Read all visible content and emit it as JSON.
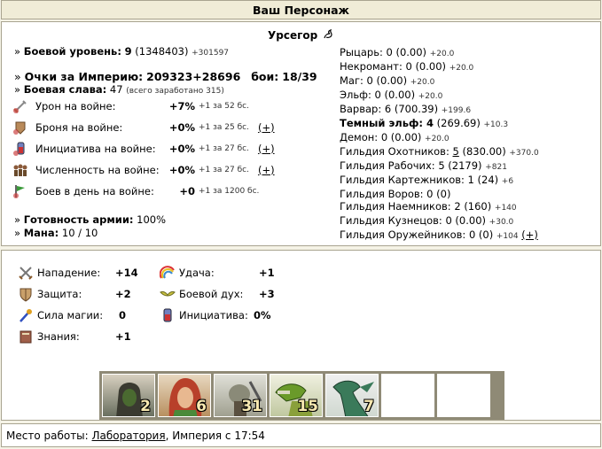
{
  "page_title": "Ваш Персонаж",
  "hero_name": "Урсегор",
  "combat_level": {
    "label": "Боевой уровень:",
    "value": "9",
    "exp": "(1348403)",
    "exp_next": "+301597"
  },
  "empire_points": {
    "label": "Очки за Империю:",
    "value": "209323+28696",
    "battles_label": "бои:",
    "battles": "18/39"
  },
  "glory": {
    "label": "Боевая слава:",
    "value": "47",
    "note": "(всего заработано 315)"
  },
  "war_stats": [
    {
      "icon": "sword-damage-icon",
      "label": "Урон на войне:",
      "value": "+7%",
      "note": "+1 за 52 бс.",
      "plus": ""
    },
    {
      "icon": "armor-icon",
      "label": "Броня на войне:",
      "value": "+0%",
      "note": "+1 за 25 бс.",
      "plus": "(+)"
    },
    {
      "icon": "initiative-icon",
      "label": "Инициатива на войне:",
      "value": "+0%",
      "note": "+1 за 27 бс.",
      "plus": "(+)"
    },
    {
      "icon": "army-size-icon",
      "label": "Численность на войне:",
      "value": "+0%",
      "note": "+1 за 27 бс.",
      "plus": "(+)"
    },
    {
      "icon": "battles-per-day-icon",
      "label": "Боев в день на войне:",
      "value": "+0",
      "note": "+1 за 1200 бс.",
      "plus": ""
    }
  ],
  "readiness": {
    "label": "Готовность армии:",
    "value": "100%"
  },
  "mana": {
    "label": "Мана:",
    "value": "10 / 10"
  },
  "factions": [
    {
      "text": "Рыцарь: 0 (0.00)",
      "bonus": "+20.0",
      "bold": false
    },
    {
      "text": "Некромант: 0 (0.00)",
      "bonus": "+20.0",
      "bold": false
    },
    {
      "text": "Маг: 0 (0.00)",
      "bonus": "+20.0",
      "bold": false
    },
    {
      "text": "Эльф: 0 (0.00)",
      "bonus": "+20.0",
      "bold": false
    },
    {
      "text": "Варвар: 6 (700.39)",
      "bonus": "+199.6",
      "bold": false
    },
    {
      "text": "Темный эльф: 4",
      "rest": " (269.69)",
      "bonus": "+10.3",
      "bold": true
    },
    {
      "text": "Демон: 0 (0.00)",
      "bonus": "+20.0",
      "bold": false
    }
  ],
  "guilds": [
    {
      "pre": "Гильдия Охотников: ",
      "link": "5",
      "post": " (830.00)",
      "bonus": "+370.0"
    },
    {
      "pre": "Гильдия Рабочих: 5 (2179)",
      "link": "",
      "post": "",
      "bonus": "+821"
    },
    {
      "pre": "Гильдия Картежников: 1 (24)",
      "link": "",
      "post": "",
      "bonus": "+6"
    },
    {
      "pre": "Гильдия Воров: 0 (0)",
      "link": "",
      "post": "",
      "bonus": ""
    },
    {
      "pre": "Гильдия Наемников: 2 (160)",
      "link": "",
      "post": "",
      "bonus": "+140"
    },
    {
      "pre": "Гильдия Кузнецов: 0 (0.00)",
      "link": "",
      "post": "",
      "bonus": "+30.0"
    },
    {
      "pre": "Гильдия Оружейников: 0 (0)",
      "link": "",
      "post": "",
      "bonus": "+104",
      "plus": "(+)"
    }
  ],
  "stats": {
    "attack": {
      "label": "Нападение:",
      "value": "+14",
      "icon": "crossed-swords-icon"
    },
    "defense": {
      "label": "Защита:",
      "value": "+2",
      "icon": "shield-icon"
    },
    "spellpower": {
      "label": "Сила магии:",
      "value": "0",
      "icon": "magic-wand-icon"
    },
    "knowledge": {
      "label": "Знания:",
      "value": "+1",
      "icon": "book-icon"
    },
    "luck": {
      "label": "Удача:",
      "value": "+1",
      "icon": "rainbow-icon"
    },
    "morale": {
      "label": "Боевой дух:",
      "value": "+3",
      "icon": "wings-icon"
    },
    "initiative": {
      "label": "Инициатива:",
      "value": "0%",
      "icon": "hourglass-icon"
    }
  },
  "army": [
    {
      "name": "hooded-assassin",
      "count": "2"
    },
    {
      "name": "red-haired-elf",
      "count": "6"
    },
    {
      "name": "goblin-warrior",
      "count": "31"
    },
    {
      "name": "green-lizard",
      "count": "15"
    },
    {
      "name": "green-dragon",
      "count": "7"
    },
    {
      "name": "empty",
      "count": ""
    },
    {
      "name": "empty",
      "count": ""
    }
  ],
  "footer": {
    "label": "Место работы: ",
    "workplace": "Лаборатория",
    "suffix": ", Империя с 17:54"
  },
  "colors": {
    "frame": "#a9a490",
    "background": "#f5f3e6",
    "title_bg": "#f0ecd7"
  }
}
